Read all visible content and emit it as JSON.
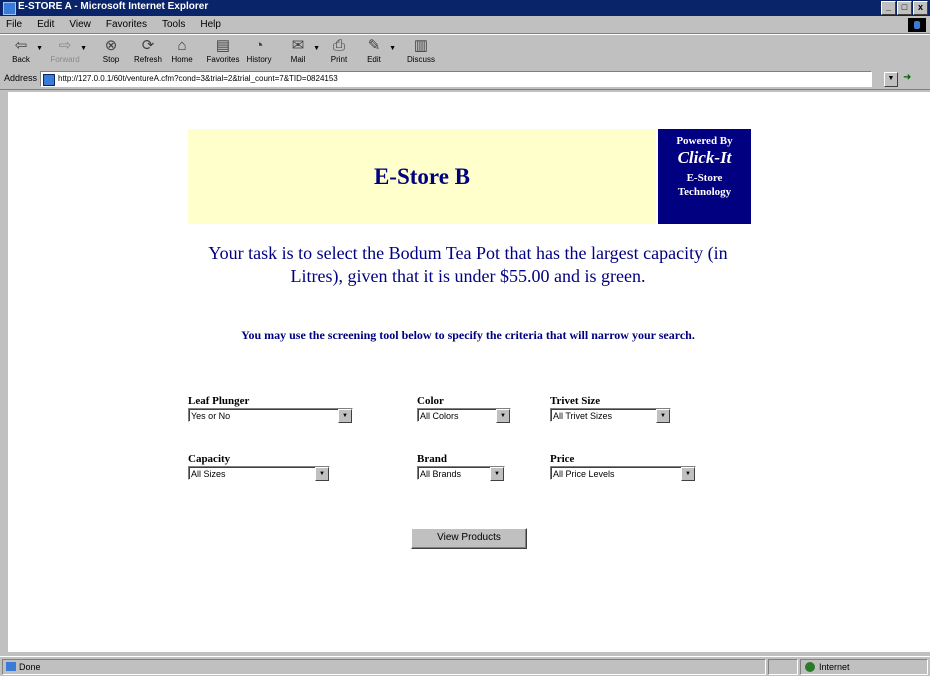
{
  "window": {
    "title": "E-STORE A - Microsoft Internet Explorer",
    "buttons": [
      "_",
      "□",
      "x"
    ]
  },
  "menu": [
    "File",
    "Edit",
    "View",
    "Favorites",
    "Tools",
    "Help"
  ],
  "toolbar": {
    "back": "Back",
    "forward": "Forward",
    "stop": "Stop",
    "refresh": "Refresh",
    "home": "Home",
    "favorites": "Favorites",
    "history": "History",
    "mail": "Mail",
    "print": "Print",
    "edit": "Edit",
    "discuss": "Discuss"
  },
  "address": {
    "label": "Address",
    "url": "http://127.0.0.1/60t/ventureA.cfm?cond=3&trial=2&trial_count=7&TID=0824153"
  },
  "page": {
    "store_name": "E-Store B",
    "powered_line1": "Powered By",
    "powered_line2": "Click-It",
    "powered_line3": "E-Store",
    "powered_line4": "Technology",
    "task": "Your task is to select the Bodum Tea Pot that has the largest capacity (in Litres), given that it is under $55.00 and is green.",
    "hint": "You may use the screening tool below to specify the criteria that will narrow your search."
  },
  "filters": {
    "leaf_plunger": {
      "label": "Leaf Plunger",
      "value": "Yes or No"
    },
    "color": {
      "label": "Color",
      "value": "All Colors"
    },
    "trivet_size": {
      "label": "Trivet Size",
      "value": "All Trivet Sizes"
    },
    "capacity": {
      "label": "Capacity",
      "value": "All Sizes"
    },
    "brand": {
      "label": "Brand",
      "value": "All Brands"
    },
    "price": {
      "label": "Price",
      "value": "All Price Levels"
    }
  },
  "view_button": "View Products",
  "status": {
    "text": "Done",
    "zone": "Internet"
  },
  "colors": {
    "title_bar": "#0a246a",
    "header_yellow": "#ffffcc",
    "navy": "#000080"
  }
}
